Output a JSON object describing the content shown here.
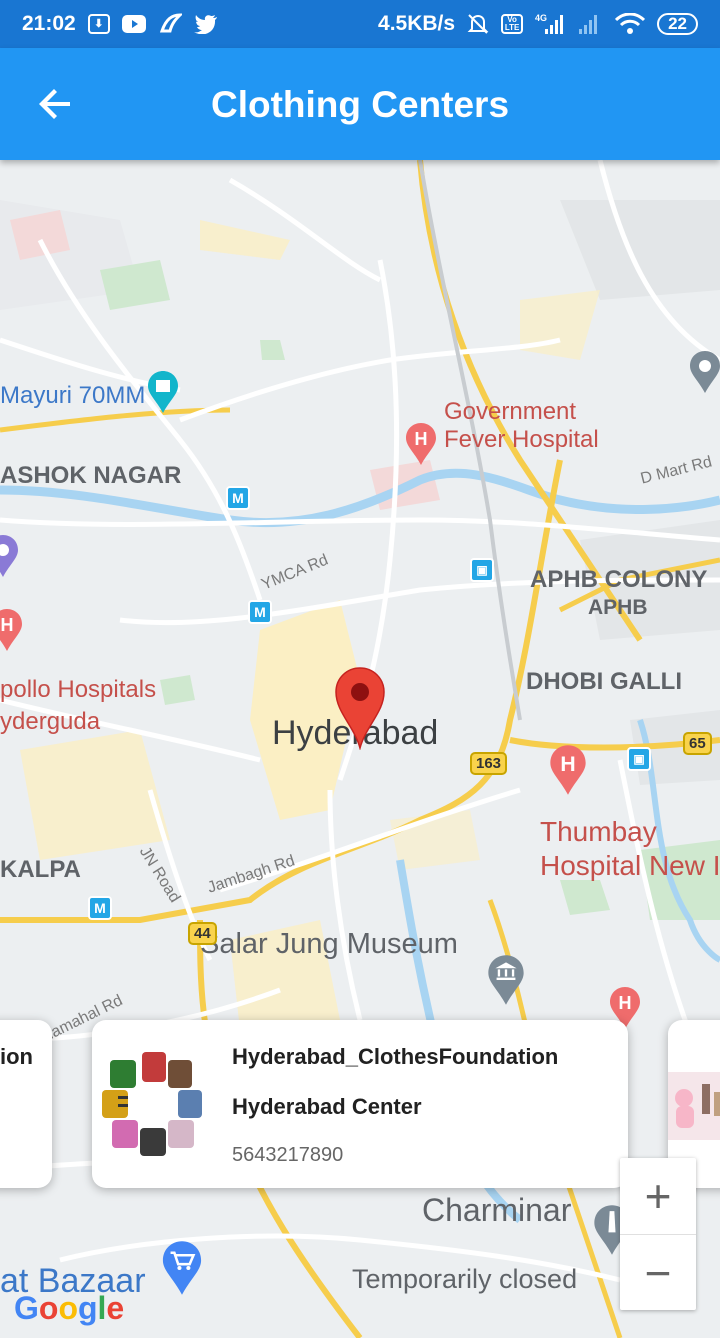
{
  "status_bar": {
    "time": "21:02",
    "network_speed": "4.5KB/s",
    "volte_label": "Vo LTE",
    "signal_label": "4G",
    "battery": "22",
    "icons": [
      "download-icon",
      "youtube-icon",
      "app-icon",
      "twitter-icon",
      "mute-icon",
      "volte-icon",
      "signal-icon",
      "signal-weak-icon",
      "wifi-icon",
      "battery-icon"
    ]
  },
  "app_bar": {
    "title": "Clothing Centers",
    "back_icon": "arrow-back-icon"
  },
  "map": {
    "labels": {
      "mayuri": "Mayuri 70MM",
      "government_1": "Government",
      "government_2": "Fever Hospital",
      "ashok_nagar": "ASHOK NAGAR",
      "dmart_rd": "D Mart Rd",
      "ymca_rd": "YMCA Rd",
      "aphb_colony": "APHB COLONY",
      "aphb": "APHB",
      "dhobi_galli": "DHOBI GALLI",
      "apollo_1": "pollo Hospitals",
      "apollo_2": "yderguda",
      "hyderabad": "Hyderabad",
      "thumbay_1": "Thumbay",
      "thumbay_2": "Hospital New I",
      "kalpa": "KALPA",
      "jn_road": "JN Road",
      "jambagh_rd": "Jambagh Rd",
      "salar_jung": "Salar Jung Museum",
      "mahal_rd": "hamahal Rd",
      "charminar": "Charminar",
      "temporarily_closed": "Temporarily closed",
      "bazaar": "at Bazaar",
      "shield_163": "163",
      "shield_65": "65",
      "shield_44": "44",
      "metro_letter": "M",
      "hospital_letter": "H"
    }
  },
  "cards": {
    "left_partial_text": "ion",
    "main": {
      "title": "Hyderabad_ClothesFoundation",
      "subtitle": "Hyderabad Center",
      "phone": "5643217890"
    }
  },
  "zoom": {
    "in": "+",
    "out": "−"
  },
  "google": [
    "G",
    "o",
    "o",
    "g",
    "l",
    "e"
  ],
  "colors": {
    "status_bar": "#1976d2",
    "app_bar": "#2196f3",
    "marker": "#ea4335",
    "hospital": "#ef6c6c",
    "metro": "#23a6e6"
  }
}
